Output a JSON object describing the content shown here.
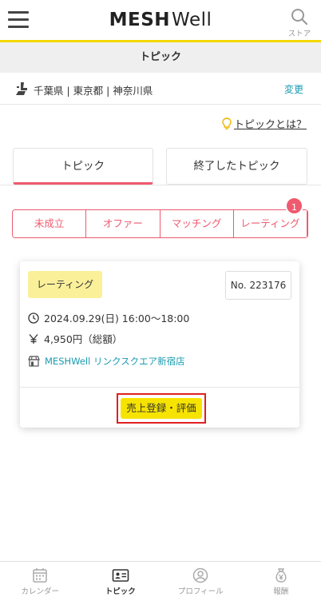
{
  "header": {
    "logo_bold": "MESH",
    "logo_light": "Well",
    "store_label": "ストア"
  },
  "page_title": "トピック",
  "area": {
    "text": "千葉県 | 東京都 | 神奈川県",
    "change_label": "変更"
  },
  "whatis_label": "トピックとは？",
  "tabs": [
    {
      "label": "トピック",
      "active": true
    },
    {
      "label": "終了したトピック",
      "active": false
    }
  ],
  "segments": [
    {
      "label": "未成立"
    },
    {
      "label": "オファー"
    },
    {
      "label": "マッチング"
    },
    {
      "label": "レーティング",
      "active": true,
      "badge": "1"
    }
  ],
  "card": {
    "status": "レーティング",
    "number": "No. 223176",
    "datetime": "2024.09.29(日) 16:00〜18:00",
    "price": "4,950円（総額）",
    "store": "MESHWell リンクスクエア新宿店",
    "action_label": "売上登録・評価"
  },
  "bottom_nav": [
    {
      "label": "カレンダー",
      "icon": "calendar-icon"
    },
    {
      "label": "トピック",
      "icon": "id-card-icon",
      "active": true
    },
    {
      "label": "プロフィール",
      "icon": "profile-icon"
    },
    {
      "label": "報酬",
      "icon": "money-bag-icon"
    }
  ],
  "colors": {
    "accent": "#ee5a6e",
    "brand_yellow": "#f5d800",
    "link": "#1a9bb0",
    "tag_yellow": "#fbf09a",
    "button_yellow": "#f7e300",
    "highlight_red": "#e02020"
  }
}
